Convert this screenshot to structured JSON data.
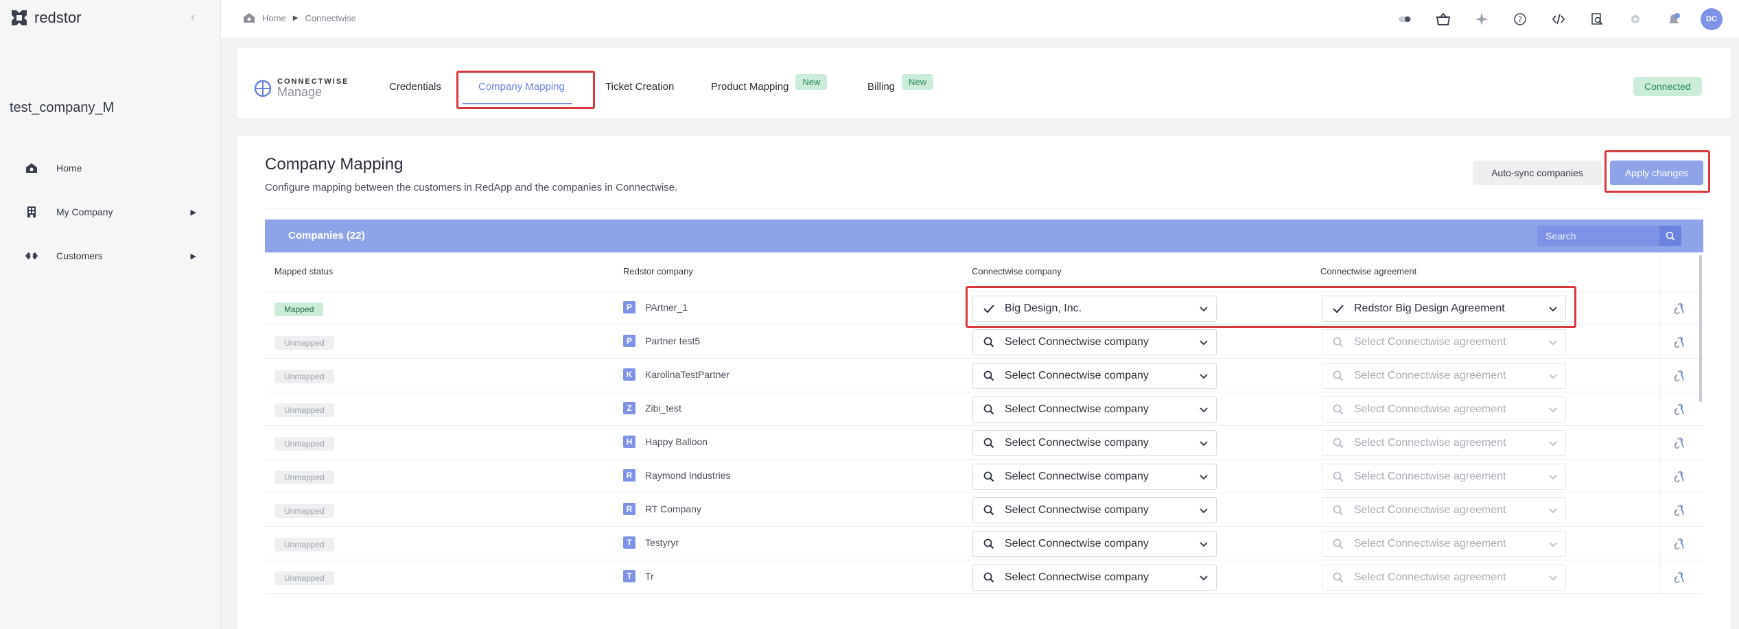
{
  "sidebar": {
    "brand": "redstor",
    "company_name": "test_company_M",
    "items": [
      {
        "label": "Home",
        "icon": "home-icon"
      },
      {
        "label": "My Company",
        "icon": "building-icon"
      },
      {
        "label": "Customers",
        "icon": "customers-icon"
      }
    ]
  },
  "breadcrumb": {
    "home": "Home",
    "current": "Connectwise"
  },
  "topbar": {
    "avatar_initials": "DC"
  },
  "integration": {
    "logo_line1": "CONNECTWISE",
    "logo_line2": "Manage",
    "tabs": [
      {
        "label": "Credentials"
      },
      {
        "label": "Company Mapping",
        "active": true
      },
      {
        "label": "Ticket Creation"
      },
      {
        "label": "Product Mapping",
        "badge": "New"
      },
      {
        "label": "Billing",
        "badge": "New"
      }
    ],
    "status": "Connected"
  },
  "mapping": {
    "title": "Company Mapping",
    "subtitle": "Configure mapping between the customers in RedApp and the companies in Connectwise.",
    "auto_sync_label": "Auto-sync companies",
    "apply_label": "Apply changes",
    "table_caption": "Companies (22)",
    "search_placeholder": "Search",
    "columns": [
      "Mapped status",
      "Redstor company",
      "Connectwise company",
      "Connectwise agreement"
    ],
    "rows": [
      {
        "status": "Mapped",
        "letter": "P",
        "company": "PArtner_1",
        "cw_company": "Big Design, Inc.",
        "cw_agreement": "Redstor Big Design Agreement",
        "mapped": true
      },
      {
        "status": "Unmapped",
        "letter": "P",
        "company": "Partner test5",
        "cw_company": "Select Connectwise company",
        "cw_agreement": "Select Connectwise agreement",
        "mapped": false
      },
      {
        "status": "Unmapped",
        "letter": "K",
        "company": "KarolinaTestPartner",
        "cw_company": "Select Connectwise company",
        "cw_agreement": "Select Connectwise agreement",
        "mapped": false
      },
      {
        "status": "Unmapped",
        "letter": "Z",
        "company": "Zibi_test",
        "cw_company": "Select Connectwise company",
        "cw_agreement": "Select Connectwise agreement",
        "mapped": false
      },
      {
        "status": "Unmapped",
        "letter": "H",
        "company": "Happy Balloon",
        "cw_company": "Select Connectwise company",
        "cw_agreement": "Select Connectwise agreement",
        "mapped": false
      },
      {
        "status": "Unmapped",
        "letter": "R",
        "company": "Raymond Industries",
        "cw_company": "Select Connectwise company",
        "cw_agreement": "Select Connectwise agreement",
        "mapped": false
      },
      {
        "status": "Unmapped",
        "letter": "R",
        "company": "RT Company",
        "cw_company": "Select Connectwise company",
        "cw_agreement": "Select Connectwise agreement",
        "mapped": false
      },
      {
        "status": "Unmapped",
        "letter": "T",
        "company": "Testyryr",
        "cw_company": "Select Connectwise company",
        "cw_agreement": "Select Connectwise agreement",
        "mapped": false
      },
      {
        "status": "Unmapped",
        "letter": "T",
        "company": "Tr",
        "cw_company": "Select Connectwise company",
        "cw_agreement": "Select Connectwise agreement",
        "mapped": false
      }
    ]
  },
  "colors": {
    "accent": "#8ea3e8",
    "accent_dark": "#6b82df",
    "success_bg": "#cbecd9",
    "success_text": "#2a8a57",
    "highlight": "#d9373b"
  }
}
